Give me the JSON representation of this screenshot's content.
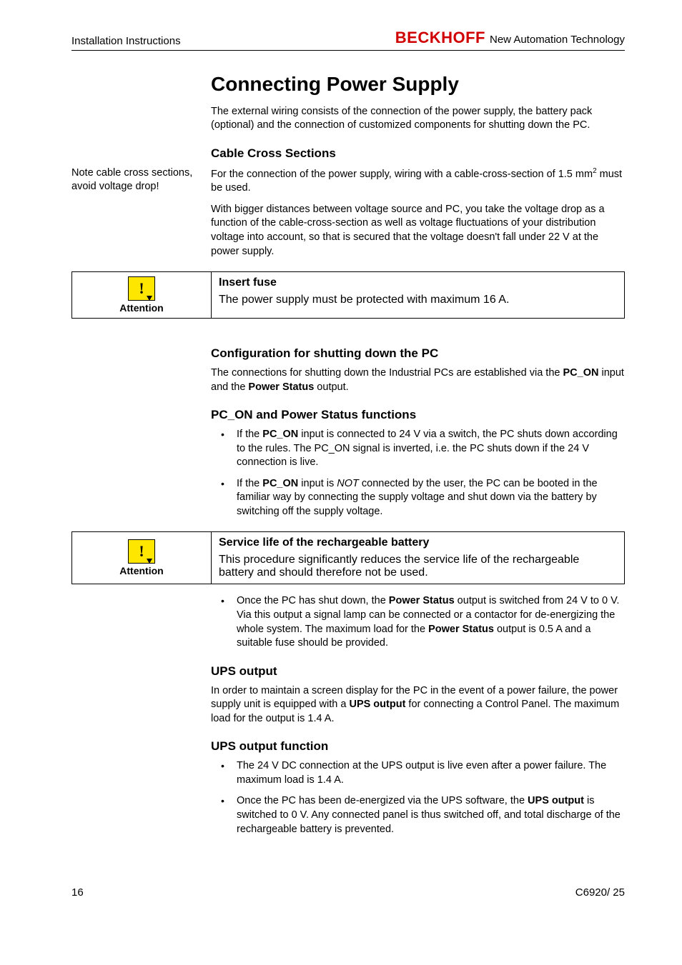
{
  "header": {
    "left": "Installation Instructions",
    "brand": "BECKHOFF",
    "tagline": "New Automation Technology"
  },
  "title": "Connecting Power Supply",
  "intro": "The external wiring consists of the connection of the power supply, the battery pack (optional) and the connection of customized components for shutting down the PC.",
  "cable": {
    "heading": "Cable Cross Sections",
    "margin_note": "Note cable cross sections, avoid voltage drop!",
    "p1_pre": "For the connection of the power supply, wiring  with a cable-cross-section of 1.5 mm",
    "p1_post": "  must be used.",
    "p2": "With bigger distances between voltage source and PC, you take the voltage drop as a function of the cable-cross-section as well as voltage fluctuations of your distribution voltage into account, so that is secured that the voltage doesn't fall under 22 V at the power supply."
  },
  "callout1": {
    "label": "Attention",
    "title": "Insert fuse",
    "body": "The power supply must be protected with maximum 16 A."
  },
  "config": {
    "heading": "Configuration for shutting down the PC",
    "p_pre": "The connections for shutting down the Industrial PCs are established via the ",
    "p_b1": "PC_ON",
    "p_mid": " input and the ",
    "p_b2": "Power Status",
    "p_post": " output."
  },
  "pcon": {
    "heading": "PC_ON and Power Status functions",
    "li1_pre": "If the ",
    "li1_b": "PC_ON",
    "li1_post": " input is connected to 24 V via a switch, the PC shuts down according to the rules. The PC_ON signal is inverted, i.e. the PC shuts down if the 24 V connection is live.",
    "li2_pre": "If the ",
    "li2_b": "PC_ON",
    "li2_mid": " input is ",
    "li2_i": "NOT",
    "li2_post": " connected by the user, the PC can be booted in the familiar way by connecting the supply voltage and shut down via the battery by switching off the supply voltage."
  },
  "callout2": {
    "label": "Attention",
    "title": "Service life of the rechargeable battery",
    "body": "This procedure significantly reduces the service life of the rechargeable battery and should therefore not be used."
  },
  "after_callout2": {
    "li_pre": "Once the PC has shut down, the ",
    "li_b1": "Power Status",
    "li_mid": " output is switched from 24 V to 0 V. Via this output a signal lamp can be connected or a contactor for de-energizing the whole system. The maximum load for the ",
    "li_b2": "Power Status",
    "li_post": " output is 0.5 A and a suitable fuse should be provided."
  },
  "ups": {
    "heading": "UPS output",
    "p_pre": "In order to maintain a screen display for the PC in the event of a power failure, the power supply unit is equipped with a ",
    "p_b": "UPS output",
    "p_post": " for connecting a Control Panel. The maximum load for the output is 1.4 A."
  },
  "upsfn": {
    "heading": "UPS output function",
    "li1": "The 24 V DC connection at the UPS output is live even after a power failure. The maximum load is 1.4 A.",
    "li2_pre": "Once the PC has been de-energized via the UPS software, the ",
    "li2_b": "UPS output",
    "li2_post": " is switched to 0 V. Any connected panel is thus switched off, and total discharge of the rechargeable battery is prevented."
  },
  "footer": {
    "page": "16",
    "doc": "C6920/ 25"
  }
}
